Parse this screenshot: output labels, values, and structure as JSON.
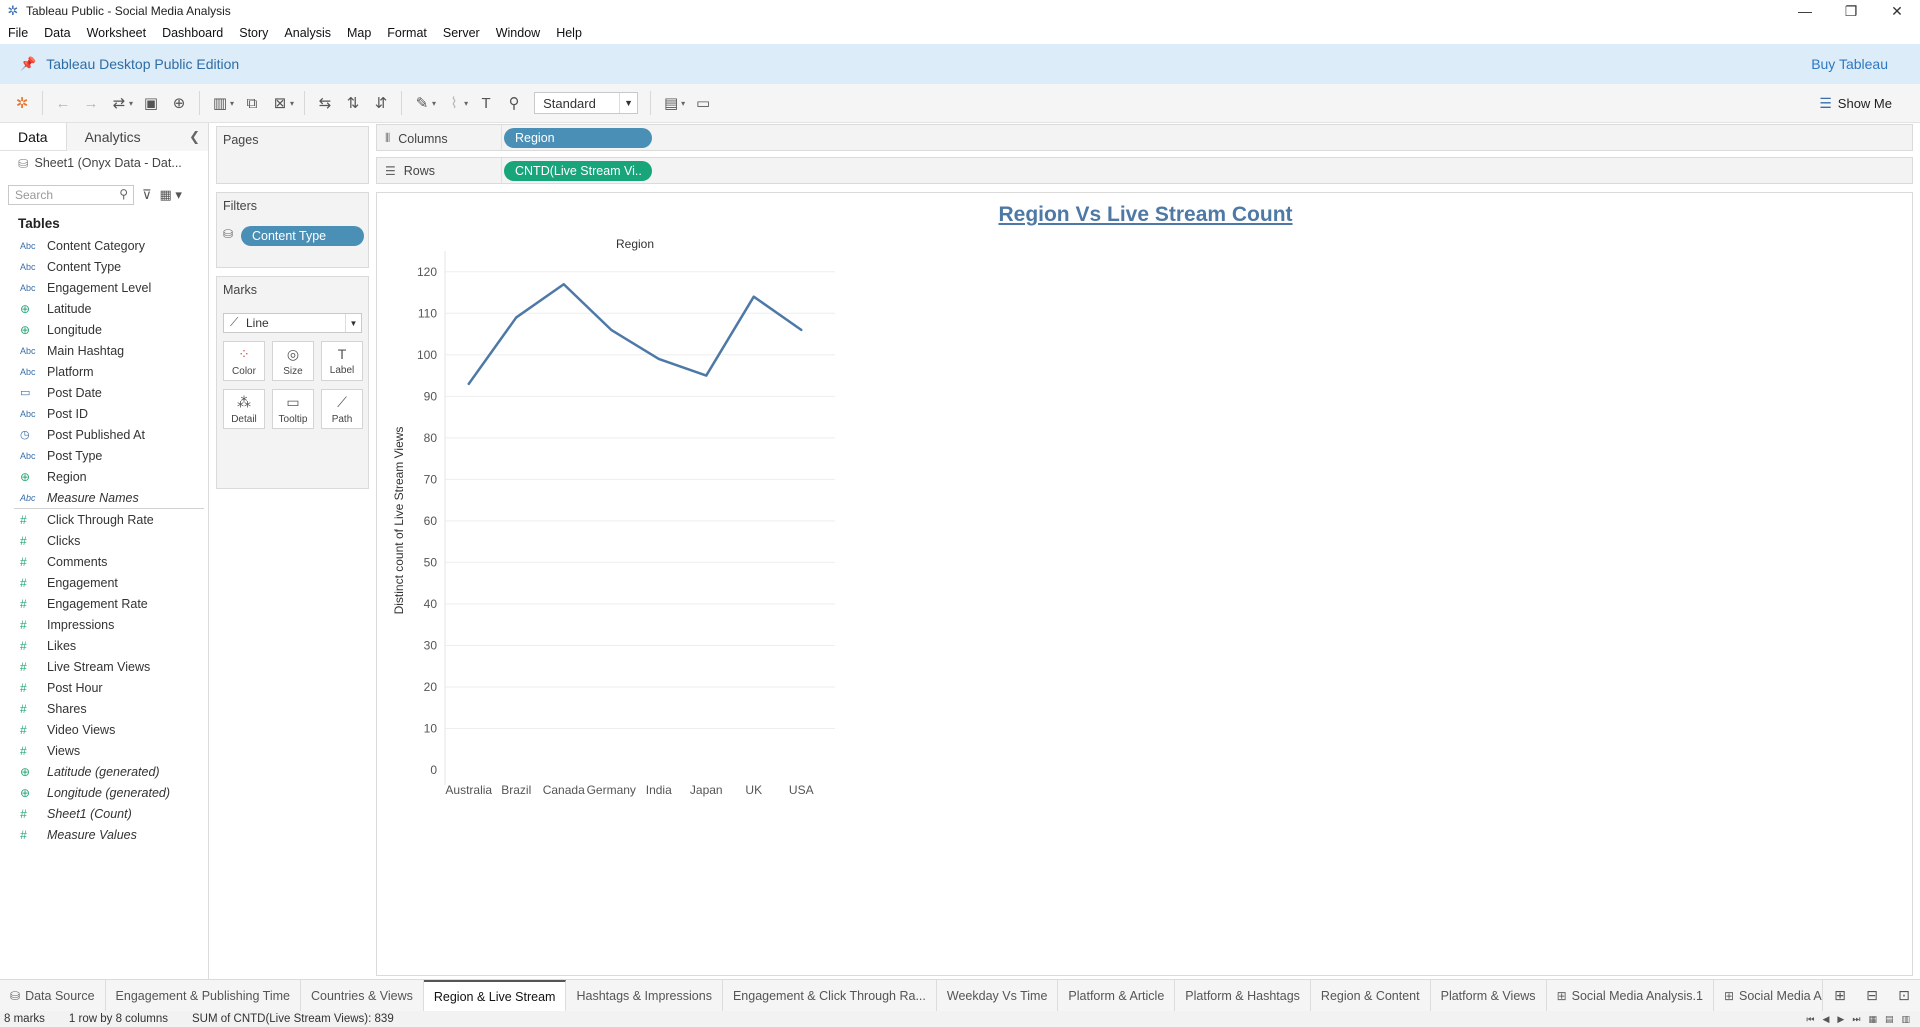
{
  "window": {
    "title": "Tableau Public - Social Media Analysis",
    "minimize": "—",
    "restore": "❐",
    "close": "✕"
  },
  "menu": [
    "File",
    "Data",
    "Worksheet",
    "Dashboard",
    "Story",
    "Analysis",
    "Map",
    "Format",
    "Server",
    "Window",
    "Help"
  ],
  "banner": {
    "edition": "Tableau Desktop Public Edition",
    "buy": "Buy Tableau"
  },
  "toolbar": {
    "fit": "Standard",
    "show_me": "Show Me"
  },
  "data_pane": {
    "tab_data": "Data",
    "tab_analytics": "Analytics",
    "datasource": "Sheet1 (Onyx Data - Dat...",
    "search_placeholder": "Search",
    "tables_heading": "Tables",
    "dimensions": [
      {
        "type": "Abc",
        "name": "Content Category"
      },
      {
        "type": "Abc",
        "name": "Content Type"
      },
      {
        "type": "Abc",
        "name": "Engagement Level"
      },
      {
        "type": "geo",
        "name": "Latitude"
      },
      {
        "type": "geo",
        "name": "Longitude"
      },
      {
        "type": "Abc",
        "name": "Main Hashtag"
      },
      {
        "type": "Abc",
        "name": "Platform"
      },
      {
        "type": "date",
        "name": "Post Date"
      },
      {
        "type": "Abc",
        "name": "Post ID"
      },
      {
        "type": "datetime",
        "name": "Post Published At"
      },
      {
        "type": "Abc",
        "name": "Post Type"
      },
      {
        "type": "geo",
        "name": "Region"
      },
      {
        "type": "Abc",
        "name": "Measure Names",
        "italic": true
      }
    ],
    "measures": [
      {
        "type": "num",
        "name": "Click Through Rate"
      },
      {
        "type": "num",
        "name": "Clicks"
      },
      {
        "type": "num",
        "name": "Comments"
      },
      {
        "type": "num",
        "name": "Engagement"
      },
      {
        "type": "num",
        "name": "Engagement Rate"
      },
      {
        "type": "num",
        "name": "Impressions"
      },
      {
        "type": "num",
        "name": "Likes"
      },
      {
        "type": "num",
        "name": "Live Stream Views"
      },
      {
        "type": "num",
        "name": "Post Hour"
      },
      {
        "type": "num",
        "name": "Shares"
      },
      {
        "type": "num",
        "name": "Video Views"
      },
      {
        "type": "num",
        "name": "Views"
      },
      {
        "type": "geo",
        "name": "Latitude (generated)",
        "italic": true
      },
      {
        "type": "geo",
        "name": "Longitude (generated)",
        "italic": true
      },
      {
        "type": "num",
        "name": "Sheet1 (Count)",
        "italic": true
      },
      {
        "type": "num",
        "name": "Measure Values",
        "italic": true
      }
    ]
  },
  "cards": {
    "pages": "Pages",
    "filters": "Filters",
    "filter_pill": "Content Type",
    "marks": "Marks",
    "mark_type": "Line",
    "mark_buttons": [
      "Color",
      "Size",
      "Label",
      "Detail",
      "Tooltip",
      "Path"
    ]
  },
  "shelves": {
    "columns_label": "Columns",
    "columns_pill": "Region",
    "rows_label": "Rows",
    "rows_pill": "CNTD(Live Stream Vi.."
  },
  "chart_data": {
    "type": "line",
    "title": "Region Vs Live Stream Count",
    "column_header": "Region",
    "ylabel": "Distinct count of Live Stream Views",
    "xlabel": "",
    "categories": [
      "Australia",
      "Brazil",
      "Canada",
      "Germany",
      "India",
      "Japan",
      "UK",
      "USA"
    ],
    "values": [
      93,
      109,
      117,
      106,
      99,
      95,
      114,
      106
    ],
    "yticks": [
      0,
      10,
      20,
      30,
      40,
      50,
      60,
      70,
      80,
      90,
      100,
      110,
      120
    ],
    "ylim": [
      0,
      125
    ],
    "line_color": "#4e79a7",
    "grid": true
  },
  "sheet_tabs": [
    {
      "label": "Data Source",
      "icon": "database-icon"
    },
    {
      "label": "Engagement & Publishing Time"
    },
    {
      "label": "Countries & Views"
    },
    {
      "label": "Region & Live Stream",
      "active": true
    },
    {
      "label": "Hashtags & Impressions"
    },
    {
      "label": "Engagement & Click Through Ra..."
    },
    {
      "label": "Weekday Vs Time"
    },
    {
      "label": "Platform & Article"
    },
    {
      "label": "Platform & Hashtags"
    },
    {
      "label": "Region & Content"
    },
    {
      "label": "Platform & Views"
    },
    {
      "label": "Social Media Analysis.1",
      "icon": "dashboard-icon"
    },
    {
      "label": "Social Media Analysis",
      "icon": "dashboard-icon"
    }
  ],
  "status": {
    "marks": "8 marks",
    "dims": "1 row by 8 columns",
    "sum": "SUM of CNTD(Live Stream Views): 839"
  }
}
